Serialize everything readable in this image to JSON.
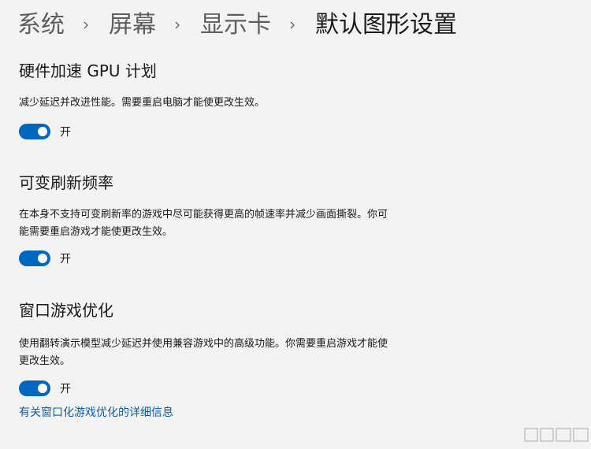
{
  "breadcrumb": {
    "items": [
      "系统",
      "屏幕",
      "显示卡",
      "默认图形设置"
    ]
  },
  "sections": [
    {
      "title": "硬件加速 GPU 计划",
      "description": "减少延迟并改进性能。需要重启电脑才能使更改生效。",
      "toggle_state": "on",
      "toggle_label": "开"
    },
    {
      "title": "可变刷新频率",
      "description": "在本身不支持可变刷新率的游戏中尽可能获得更高的帧速率并减少画面撕裂。你可能需要重启游戏才能使更改生效。",
      "toggle_state": "on",
      "toggle_label": "开"
    },
    {
      "title": "窗口游戏优化",
      "description": "使用翻转演示模型减少延迟并使用兼容游戏中的高级功能。你需要重启游戏才能使更改生效。",
      "toggle_state": "on",
      "toggle_label": "开"
    }
  ],
  "link": {
    "label": "有关窗口化游戏优化的详细信息"
  },
  "colors": {
    "accent": "#0067c0",
    "link": "#0b5ca8",
    "background": "#f3f3f3"
  },
  "icons": {
    "breadcrumb_separator": "chevron-right-icon"
  }
}
